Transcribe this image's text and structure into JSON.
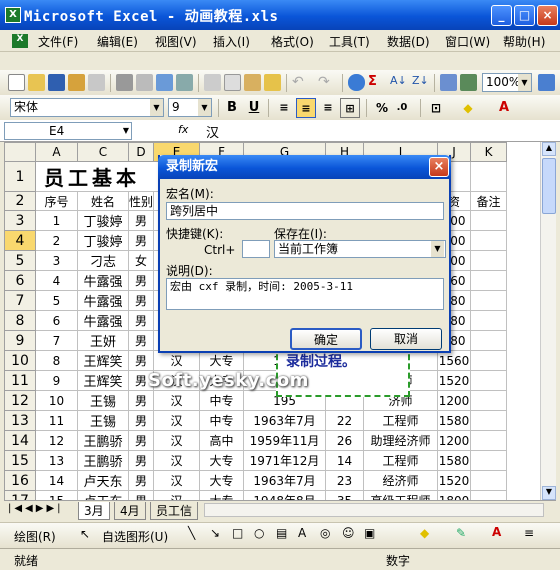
{
  "window": {
    "title": "Microsoft Excel - 动画教程.xls"
  },
  "menu": [
    "文件(F)",
    "编辑(E)",
    "视图(V)",
    "插入(I)",
    "格式(O)",
    "工具(T)",
    "数据(D)",
    "窗口(W)",
    "帮助(H)"
  ],
  "format_bar": {
    "font": "宋体",
    "size": "9"
  },
  "formula_bar": {
    "cell_ref": "E4",
    "fx": "fx",
    "content": "汉"
  },
  "sheet": {
    "col_headers": [
      "A",
      "C",
      "D",
      "E",
      "F",
      "G",
      "H",
      "I",
      "J",
      "K"
    ],
    "title_row": {
      "num": "1",
      "text": "员工基本"
    },
    "header_row": {
      "num": "2",
      "cells": [
        "序号",
        "姓名",
        "性别",
        "",
        "",
        "",
        "",
        "",
        "资",
        "备注"
      ]
    },
    "rows": [
      {
        "num": "3",
        "cells": [
          "1",
          "丁骏婷",
          "男",
          "",
          "",
          "",
          "",
          "",
          "200",
          ""
        ]
      },
      {
        "num": "4",
        "cells": [
          "2",
          "丁骏婷",
          "男",
          "",
          "",
          "",
          "",
          "",
          "200",
          ""
        ]
      },
      {
        "num": "5",
        "cells": [
          "3",
          "刁志",
          "女",
          "",
          "",
          "",
          "",
          "",
          "200",
          ""
        ]
      },
      {
        "num": "6",
        "cells": [
          "4",
          "牛露强",
          "男",
          "",
          "",
          "",
          "",
          "",
          "160",
          ""
        ]
      },
      {
        "num": "7",
        "cells": [
          "5",
          "牛露强",
          "男",
          "",
          "",
          "",
          "",
          "",
          "280",
          ""
        ]
      },
      {
        "num": "8",
        "cells": [
          "6",
          "牛露强",
          "男",
          "",
          "",
          "",
          "",
          "",
          "280",
          ""
        ]
      },
      {
        "num": "9",
        "cells": [
          "7",
          "王妍",
          "男",
          "",
          "",
          "",
          "",
          "",
          "280",
          ""
        ]
      },
      {
        "num": "10",
        "cells": [
          "8",
          "王辉笑",
          "男",
          "汉",
          "大专",
          "196",
          "",
          "",
          "1560",
          ""
        ]
      },
      {
        "num": "11",
        "cells": [
          "9",
          "王辉笑",
          "男",
          "汉",
          "大专",
          "",
          "",
          "济师",
          "1520",
          ""
        ]
      },
      {
        "num": "12",
        "cells": [
          "10",
          "王锡",
          "男",
          "汉",
          "中专",
          "195",
          "",
          "济师",
          "1200",
          ""
        ]
      },
      {
        "num": "13",
        "cells": [
          "11",
          "王锡",
          "男",
          "汉",
          "中专",
          "1963年7月",
          "22",
          "工程师",
          "1580",
          ""
        ]
      },
      {
        "num": "14",
        "cells": [
          "12",
          "王鹏骄",
          "男",
          "汉",
          "高中",
          "1959年11月",
          "26",
          "助理经济师",
          "1200",
          ""
        ]
      },
      {
        "num": "15",
        "cells": [
          "13",
          "王鹏骄",
          "男",
          "汉",
          "大专",
          "1971年12月",
          "14",
          "工程师",
          "1580",
          ""
        ]
      },
      {
        "num": "16",
        "cells": [
          "14",
          "卢天东",
          "男",
          "汉",
          "大专",
          "1963年7月",
          "23",
          "经济师",
          "1520",
          ""
        ]
      },
      {
        "num": "17",
        "cells": [
          "15",
          "卢天东",
          "男",
          "汉",
          "大专",
          "1948年8月",
          "35",
          "高级工程师",
          "1800",
          ""
        ]
      }
    ]
  },
  "sheet_tabs": [
    "3月",
    "4月",
    "员工信"
  ],
  "draw_toolbar": {
    "draw": "绘图(R)",
    "autoshape": "自选图形(U)"
  },
  "status": {
    "left": "就绪",
    "num": "数字"
  },
  "dialog": {
    "title": "录制新宏",
    "name_label": "宏名(M):",
    "name_value": "跨列居中",
    "shortcut_label": "快捷键(K):",
    "ctrl": "Ctrl+",
    "store_label": "保存在(I):",
    "store_value": "当前工作簿",
    "desc_label": "说明(D):",
    "desc_value": "宏由 cxf 录制，时间: 2005-3-11",
    "ok": "确定",
    "cancel": "取消"
  },
  "caption": "录制过程。",
  "watermark": "Soft.yesky.com",
  "colors": {
    "title_blue": "#0a55d8",
    "selected_header": "#f9d86e",
    "dashed_green": "#2a9b2a"
  }
}
